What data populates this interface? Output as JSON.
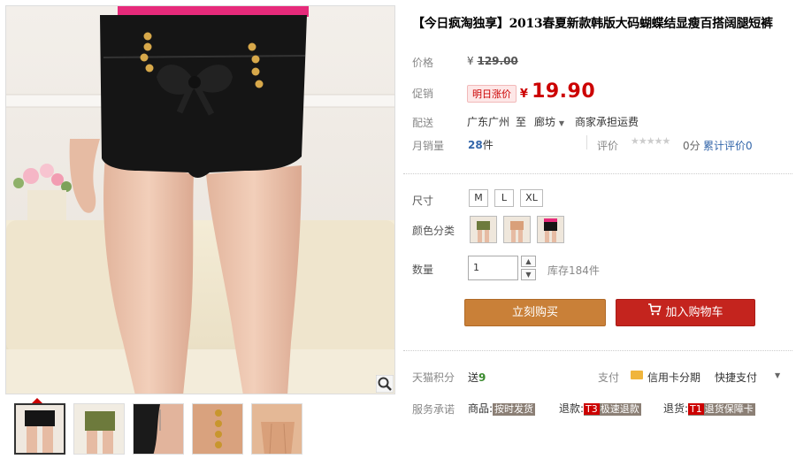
{
  "product": {
    "title": "【今日疯淘独享】2013春夏新款韩版大码蝴蝶结显瘦百搭阔腿短裤"
  },
  "price": {
    "label": "价格",
    "currency": "¥",
    "original": "129.00"
  },
  "promo": {
    "label": "促销",
    "tag": "明日涨价",
    "currency": "¥",
    "price": "19.90"
  },
  "shipping": {
    "label": "配送",
    "from": "广东广州",
    "to_word": "至",
    "dest": "廊坊",
    "fee": "商家承担运费"
  },
  "sales": {
    "label": "月销量",
    "count": "28",
    "unit": "件",
    "rating_label": "评价",
    "score": "0分",
    "total_reviews": "累计评价0"
  },
  "size": {
    "label": "尺寸",
    "options": [
      "M",
      "L",
      "XL"
    ]
  },
  "color": {
    "label": "颜色分类"
  },
  "quantity": {
    "label": "数量",
    "value": "1",
    "stock": "库存184件"
  },
  "buttons": {
    "buy_now": "立刻购买",
    "add_cart": "加入购物车"
  },
  "points": {
    "label": "天猫积分",
    "send": "送",
    "amount": "9"
  },
  "payment": {
    "label": "支付",
    "credit": "信用卡分期",
    "quick": "快捷支付"
  },
  "service": {
    "label": "服务承诺",
    "goods_prefix": "商品:",
    "goods_tag": "按时发货",
    "refund_prefix": "退款:",
    "refund_code": "T3",
    "refund_tag": "极速退款",
    "return_prefix": "退货:",
    "return_code": "T1",
    "return_tag": "退货保障卡"
  },
  "colors": {
    "promo_red": "#cc0000",
    "buy_button": "#c98038",
    "cart_button": "#c4241e",
    "link_blue": "#3366aa"
  }
}
